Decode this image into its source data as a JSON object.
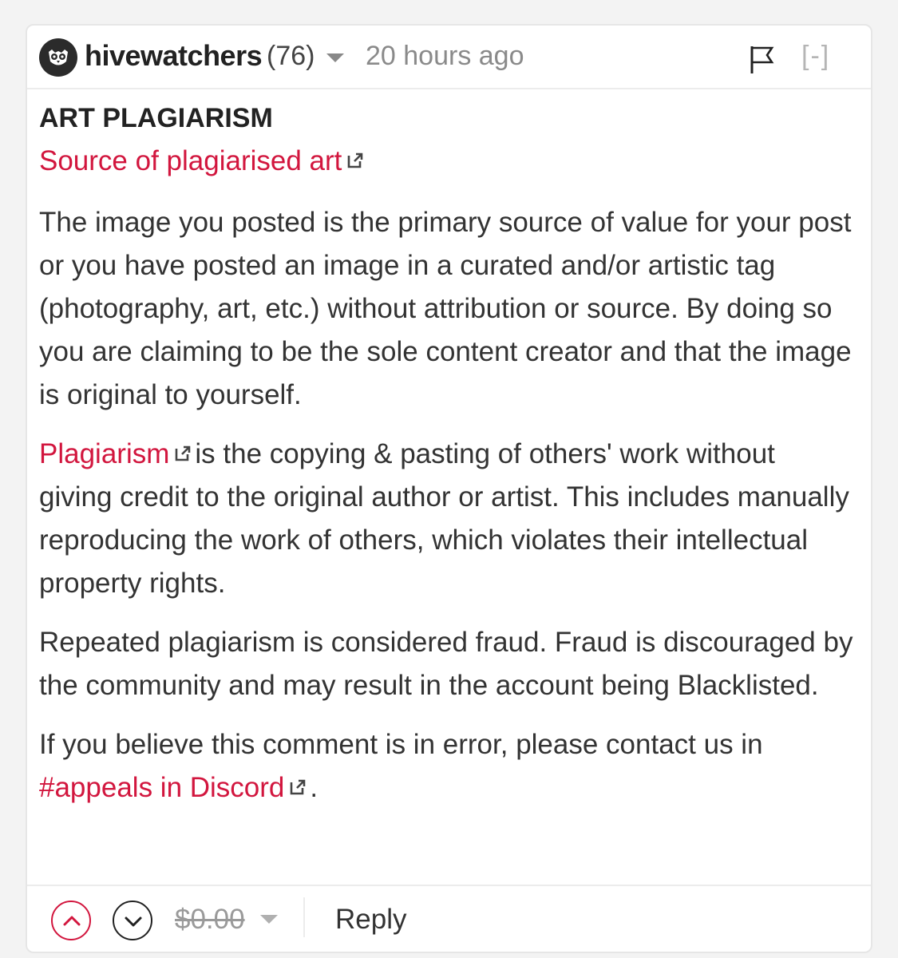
{
  "comment": {
    "author": "hivewatchers",
    "reputation": "(76)",
    "timestamp": "20 hours ago",
    "collapse_label": "[-]",
    "title": "ART PLAGIARISM",
    "source_link": "Source of plagiarised art",
    "para1": "The image you posted is the primary source of value for your post or you have posted an image in a curated and/or artistic tag (photography, art, etc.) without attribution or source. By doing so you are claiming to be the sole content creator and that the image is original to yourself.",
    "para2_link": "Plagiarism",
    "para2_rest": "is the copying & pasting of others' work without giving credit to the original author or artist. This includes manually reproducing the work of others, which violates their intellectual property rights.",
    "para3": "Repeated plagiarism is considered fraud. Fraud is discouraged by the community and may result in the account being Blacklisted.",
    "para4_text": "If you believe this comment is in error, please contact us in",
    "para4_link": "#appeals in Discord",
    "para4_end": "."
  },
  "footer": {
    "payout": "$0.00",
    "reply_label": "Reply"
  },
  "icons": {
    "avatar": "owl-logo",
    "flag": "flag-icon",
    "upvote": "chevron-up-icon",
    "downvote": "chevron-down-icon",
    "external": "external-link-icon"
  },
  "colors": {
    "accent": "#d2163e",
    "text": "#333333",
    "muted": "#8a8a8a"
  }
}
